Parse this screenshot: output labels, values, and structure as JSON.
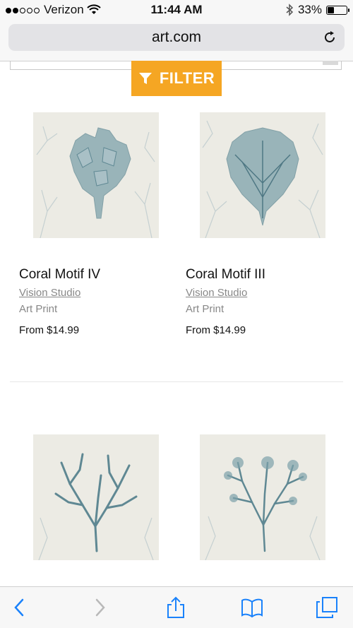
{
  "status_bar": {
    "carrier": "Verizon",
    "time": "11:44 AM",
    "battery": "33%",
    "signal_icon": "signal-dots-icon",
    "wifi_icon": "wifi-icon",
    "bluetooth_icon": "bluetooth-icon"
  },
  "browser": {
    "url": "art.com",
    "reload_icon": "reload-icon"
  },
  "filter": {
    "label": "FILTER",
    "icon": "funnel-icon",
    "color": "#f5a623"
  },
  "products": [
    {
      "title": "Coral Motif IV",
      "artist": "Vision Studio",
      "type": "Art Print",
      "price": "From $14.99"
    },
    {
      "title": "Coral Motif III",
      "artist": "Vision Studio",
      "type": "Art Print",
      "price": "From $14.99"
    },
    {
      "title": "",
      "artist": "",
      "type": "",
      "price": ""
    },
    {
      "title": "",
      "artist": "",
      "type": "",
      "price": ""
    }
  ],
  "toolbar": {
    "back_icon": "back-chevron-icon",
    "forward_icon": "forward-chevron-icon",
    "share_icon": "share-icon",
    "bookmarks_icon": "book-icon",
    "tabs_icon": "tabs-icon",
    "accent_color": "#1a82fb"
  }
}
